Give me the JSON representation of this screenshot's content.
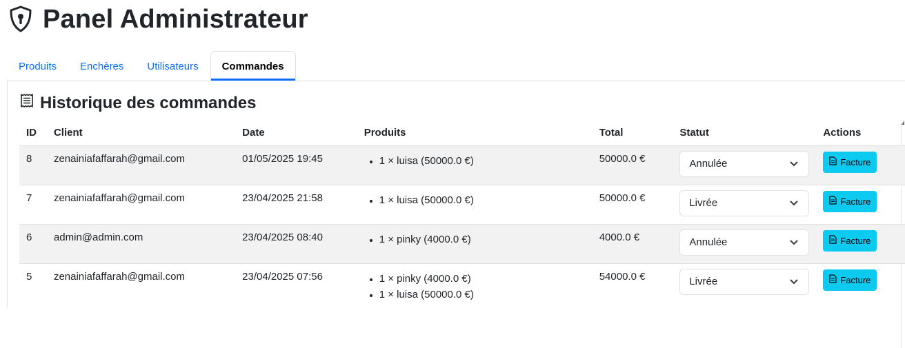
{
  "header": {
    "title": "Panel Administrateur",
    "icon": "shield-lock-icon"
  },
  "tabs": [
    {
      "label": "Produits",
      "active": false
    },
    {
      "label": "Enchères",
      "active": false
    },
    {
      "label": "Utilisateurs",
      "active": false
    },
    {
      "label": "Commandes",
      "active": true
    }
  ],
  "section": {
    "title": "Historique des commandes",
    "icon": "receipt-icon"
  },
  "table": {
    "headers": [
      "ID",
      "Client",
      "Date",
      "Produits",
      "Total",
      "Statut",
      "Actions"
    ],
    "rows": [
      {
        "id": "8",
        "client": "zenainiafaffarah@gmail.com",
        "date": "01/05/2025 19:45",
        "products": [
          "1 × luisa (50000.0 €)"
        ],
        "total": "50000.0 €",
        "status": "Annulée",
        "action": "Facture"
      },
      {
        "id": "7",
        "client": "zenainiafaffarah@gmail.com",
        "date": "23/04/2025 21:58",
        "products": [
          "1 × luisa (50000.0 €)"
        ],
        "total": "50000.0 €",
        "status": "Livrée",
        "action": "Facture"
      },
      {
        "id": "6",
        "client": "admin@admin.com",
        "date": "23/04/2025 08:40",
        "products": [
          "1 × pinky (4000.0 €)"
        ],
        "total": "4000.0 €",
        "status": "Annulée",
        "action": "Facture"
      },
      {
        "id": "5",
        "client": "zenainiafaffarah@gmail.com",
        "date": "23/04/2025 07:56",
        "products": [
          "1 × pinky (4000.0 €)",
          "1 × luisa (50000.0 €)"
        ],
        "total": "54000.0 €",
        "status": "Livrée",
        "action": "Facture"
      }
    ]
  },
  "colors": {
    "accent": "#0d6efd",
    "button": "#0dcaf0",
    "stripe": "#f2f2f2"
  }
}
